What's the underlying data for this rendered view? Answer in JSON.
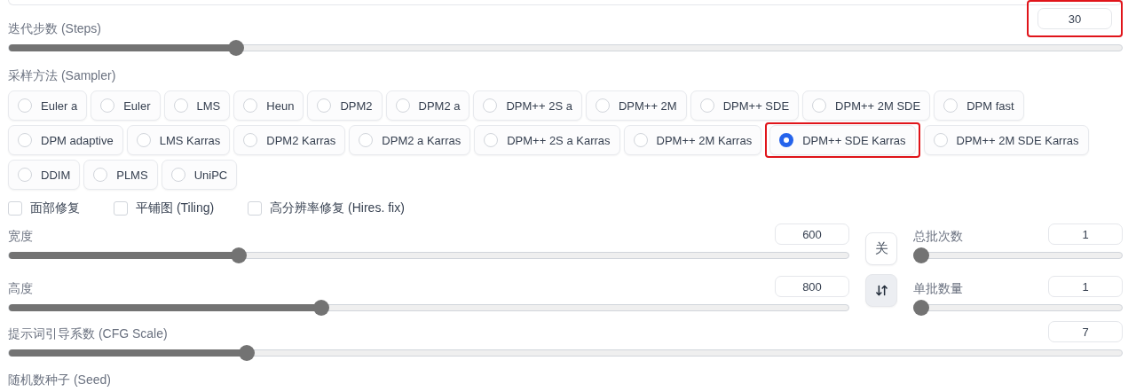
{
  "steps": {
    "label": "迭代步数 (Steps)",
    "value": "30",
    "level": 0.2,
    "highlighted": true
  },
  "sampler": {
    "label": "采样方法 (Sampler)",
    "options": [
      {
        "label": "Euler a",
        "selected": false,
        "highlighted": false
      },
      {
        "label": "Euler",
        "selected": false,
        "highlighted": false
      },
      {
        "label": "LMS",
        "selected": false,
        "highlighted": false
      },
      {
        "label": "Heun",
        "selected": false,
        "highlighted": false
      },
      {
        "label": "DPM2",
        "selected": false,
        "highlighted": false
      },
      {
        "label": "DPM2 a",
        "selected": false,
        "highlighted": false
      },
      {
        "label": "DPM++ 2S a",
        "selected": false,
        "highlighted": false
      },
      {
        "label": "DPM++ 2M",
        "selected": false,
        "highlighted": false
      },
      {
        "label": "DPM++ SDE",
        "selected": false,
        "highlighted": false
      },
      {
        "label": "DPM++ 2M SDE",
        "selected": false,
        "highlighted": false
      },
      {
        "label": "DPM fast",
        "selected": false,
        "highlighted": false
      },
      {
        "label": "DPM adaptive",
        "selected": false,
        "highlighted": false
      },
      {
        "label": "LMS Karras",
        "selected": false,
        "highlighted": false
      },
      {
        "label": "DPM2 Karras",
        "selected": false,
        "highlighted": false
      },
      {
        "label": "DPM2 a Karras",
        "selected": false,
        "highlighted": false
      },
      {
        "label": "DPM++ 2S a Karras",
        "selected": false,
        "highlighted": false
      },
      {
        "label": "DPM++ 2M Karras",
        "selected": false,
        "highlighted": false
      },
      {
        "label": "DPM++ SDE Karras",
        "selected": true,
        "highlighted": true
      },
      {
        "label": "DPM++ 2M SDE Karras",
        "selected": false,
        "highlighted": false
      },
      {
        "label": "DDIM",
        "selected": false,
        "highlighted": false
      },
      {
        "label": "PLMS",
        "selected": false,
        "highlighted": false
      },
      {
        "label": "UniPC",
        "selected": false,
        "highlighted": false
      }
    ]
  },
  "checkboxes": [
    {
      "label": "面部修复",
      "checked": false
    },
    {
      "label": "平铺图 (Tiling)",
      "checked": false
    },
    {
      "label": "高分辨率修复 (Hires. fix)",
      "checked": false
    }
  ],
  "width": {
    "label": "宽度",
    "value": "600",
    "level": 0.27
  },
  "height": {
    "label": "高度",
    "value": "800",
    "level": 0.37
  },
  "dimension_buttons": [
    {
      "kind": "close",
      "label": "关"
    },
    {
      "kind": "swap"
    }
  ],
  "batch_count": {
    "label": "总批次数",
    "value": "1",
    "level": 0
  },
  "batch_size": {
    "label": "单批数量",
    "value": "1",
    "level": 0
  },
  "cfg_scale": {
    "label": "提示词引导系数 (CFG Scale)",
    "value": "7",
    "level": 0.21
  },
  "seed": {
    "label": "随机数种子 (Seed)"
  }
}
